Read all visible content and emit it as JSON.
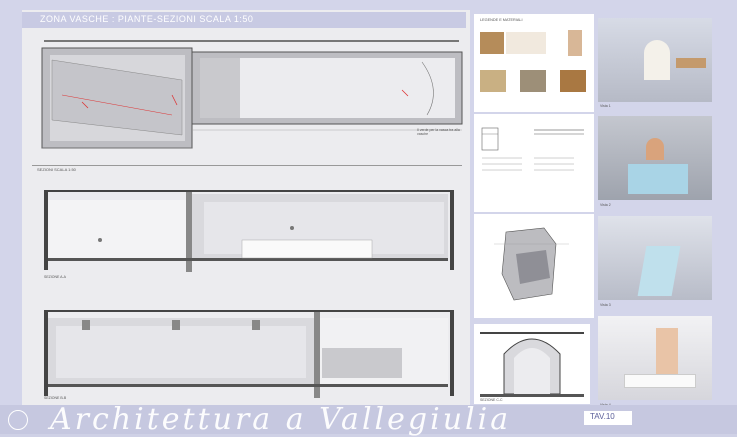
{
  "sheet": {
    "title": "ZONA VASCHE : PIANTE-SEZIONI SCALA 1:50",
    "section_label": "SEZIONI SCALA 1:50",
    "materials_label": "LEGENDE E MATERIALI",
    "brand": "Architettura a Vallegiulia",
    "tav": "TAV.10",
    "views": [
      "Vista 1",
      "Vista 2",
      "Vista 3",
      "Vista 4"
    ],
    "section_a": "SEZIONE A-A",
    "section_b": "SEZIONE B-B",
    "section_c": "SEZIONE C-C",
    "plan_note": "Il verde per la vasca tra alla vasche"
  },
  "colors": {
    "background": "#d3d5ea",
    "header": "#c8cae3",
    "sheet": "#ececef",
    "accent": "#5b5f9a",
    "pool": "#a9d4e6",
    "wood": "#c49a6c"
  },
  "icons": [
    "seal-logo-icon"
  ]
}
